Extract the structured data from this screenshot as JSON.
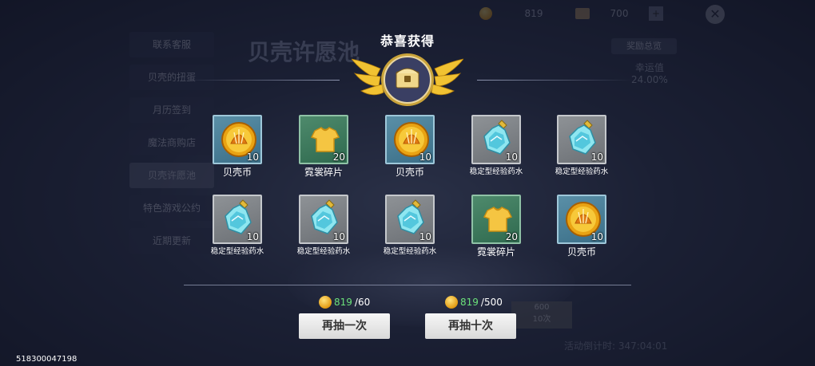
{
  "background": {
    "sidebar": [
      "联系客服",
      "贝壳的扭蛋",
      "月历签到",
      "魔法商购店",
      "贝壳许愿池",
      "特色游戏公约",
      "近期更新"
    ],
    "banner_title": "贝壳许愿池",
    "currency_1": "819",
    "currency_2": "700",
    "gift_label": "奖励总览",
    "luck_label": "幸运值",
    "luck_value": "24.00%",
    "countdown": "活动倒计时: 347:04:01",
    "ghost_price": "600",
    "ghost_label": "10次"
  },
  "popup": {
    "title": "恭喜获得",
    "items": [
      {
        "name": "贝壳币",
        "count": "10",
        "icon": "shell-coin-icon",
        "quality": "blue"
      },
      {
        "name": "霓裳碎片",
        "count": "20",
        "icon": "shirt-icon",
        "quality": "green"
      },
      {
        "name": "贝壳币",
        "count": "10",
        "icon": "shell-coin-icon",
        "quality": "blue"
      },
      {
        "name": "稳定型经验药水",
        "count": "10",
        "icon": "potion-icon",
        "quality": "gray"
      },
      {
        "name": "稳定型经验药水",
        "count": "10",
        "icon": "potion-icon",
        "quality": "gray"
      },
      {
        "name": "稳定型经验药水",
        "count": "10",
        "icon": "potion-icon",
        "quality": "gray"
      },
      {
        "name": "稳定型经验药水",
        "count": "10",
        "icon": "potion-icon",
        "quality": "gray"
      },
      {
        "name": "稳定型经验药水",
        "count": "10",
        "icon": "potion-icon",
        "quality": "gray"
      },
      {
        "name": "霓裳碎片",
        "count": "20",
        "icon": "shirt-icon",
        "quality": "green"
      },
      {
        "name": "贝壳币",
        "count": "10",
        "icon": "shell-coin-icon",
        "quality": "blue"
      }
    ],
    "draw_once": {
      "label": "再抽一次",
      "have": "819",
      "need": "/60"
    },
    "draw_ten": {
      "label": "再抽十次",
      "have": "819",
      "need": "/500"
    }
  },
  "user_id": "518300047198"
}
